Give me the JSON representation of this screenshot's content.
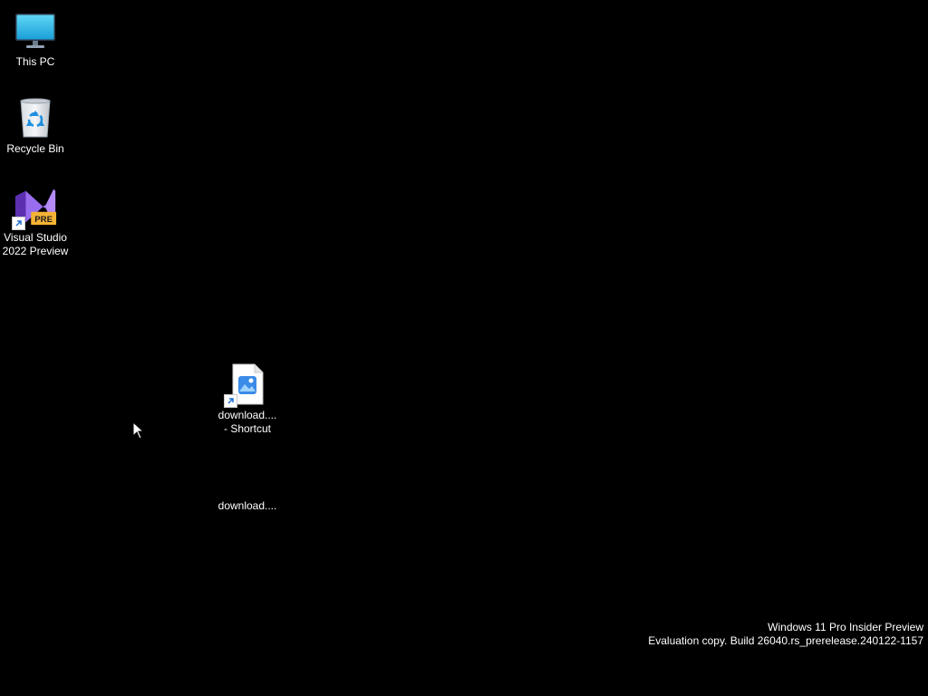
{
  "desktop": {
    "background_color": "#000000",
    "icons": [
      {
        "label": "This PC",
        "icon": "monitor-icon"
      },
      {
        "label": "Recycle Bin",
        "icon": "recycle-bin-icon"
      },
      {
        "label": "Visual Studio 2022 Preview",
        "icon": "visual-studio-preview-icon",
        "badge": "PRE"
      },
      {
        "label": "download....\n- Shortcut",
        "icon": "image-file-shortcut-icon"
      },
      {
        "label": "download....",
        "icon": "blank-file-icon"
      }
    ]
  },
  "watermark": {
    "line1": "Windows 11 Pro Insider Preview",
    "line2": "Evaluation copy. Build 26040.rs_prerelease.240122-1157"
  }
}
